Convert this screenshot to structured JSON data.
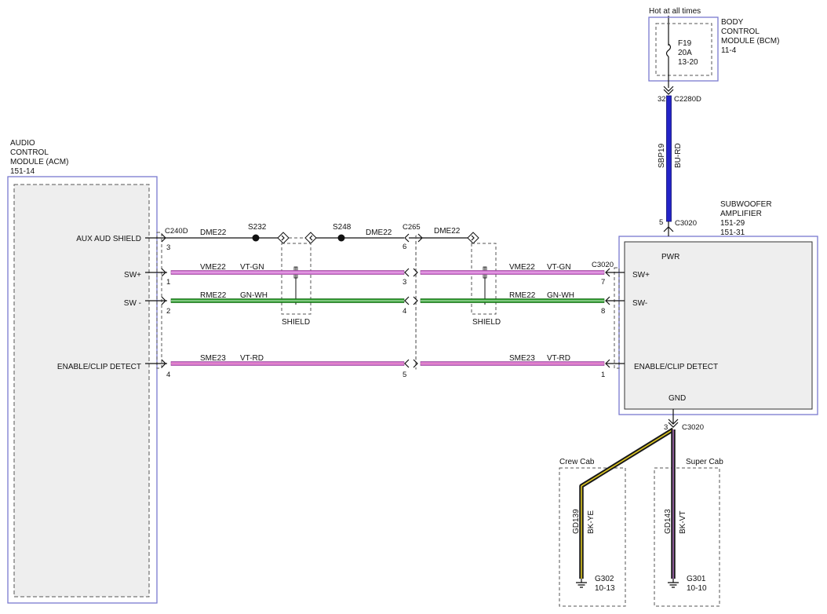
{
  "bcm": {
    "power_label": "Hot at all times",
    "title": [
      "BODY",
      "CONTROL",
      "MODULE (BCM)",
      "11-4"
    ],
    "fuse": [
      "F19",
      "20A",
      "13-20"
    ],
    "connector": "C2280D",
    "pin": "32"
  },
  "feed_wire": {
    "circuit": "SBP19",
    "color_code": "BU-RD",
    "color": "#2424c8"
  },
  "acm": {
    "title": [
      "AUDIO",
      "CONTROL",
      "MODULE (ACM)",
      "151-14"
    ],
    "connector": "C240D",
    "pins": [
      {
        "label": "AUX AUD SHIELD",
        "pin": "3"
      },
      {
        "label": "SW+",
        "pin": "1"
      },
      {
        "label": "SW -",
        "pin": "2"
      },
      {
        "label": "ENABLE/CLIP DETECT",
        "pin": "4"
      }
    ]
  },
  "amp": {
    "title": [
      "SUBWOOFER",
      "AMPLIFIER",
      "151-29",
      "151-31"
    ],
    "pwr_label": "PWR",
    "pwr_connector": "C3020",
    "pwr_pin": "5",
    "connector": "C3020",
    "pins": [
      {
        "label": "SW+",
        "pin": "7"
      },
      {
        "label": "SW-",
        "pin": "8"
      },
      {
        "label": "ENABLE/CLIP DETECT",
        "pin": "1"
      }
    ],
    "gnd_label": "GND",
    "gnd_connector": "C3020",
    "gnd_pin": "3"
  },
  "inline_connector": {
    "name": "C265",
    "pins": [
      "6",
      "3",
      "4",
      "5"
    ]
  },
  "splices": [
    "S232",
    "S248"
  ],
  "shield_label": "SHIELD",
  "circuits": {
    "shield": "DME22",
    "sw_plus": {
      "circuit": "VME22",
      "color_code": "VT-GN",
      "color": "#d070d0",
      "stripe": "#e8b0e8"
    },
    "sw_minus": {
      "circuit": "RME22",
      "color_code": "GN-WH",
      "color": "#2a9a2a",
      "stripe": "#b8e0b8"
    },
    "enable": {
      "circuit": "SME23",
      "color_code": "VT-RD",
      "color": "#d070d0",
      "stripe": "#ea90c0"
    }
  },
  "grounds": [
    {
      "variant": "Crew Cab",
      "circuit": "GD139",
      "color_code": "BK-YE",
      "ground": "G302",
      "page": "10-13",
      "color": "#1a1a1a",
      "stripe": "#e8d020"
    },
    {
      "variant": "Super Cab",
      "circuit": "GD143",
      "color_code": "BK-VT",
      "ground": "G301",
      "page": "10-10",
      "color": "#1a1a1a",
      "stripe": "#b070c0"
    }
  ]
}
